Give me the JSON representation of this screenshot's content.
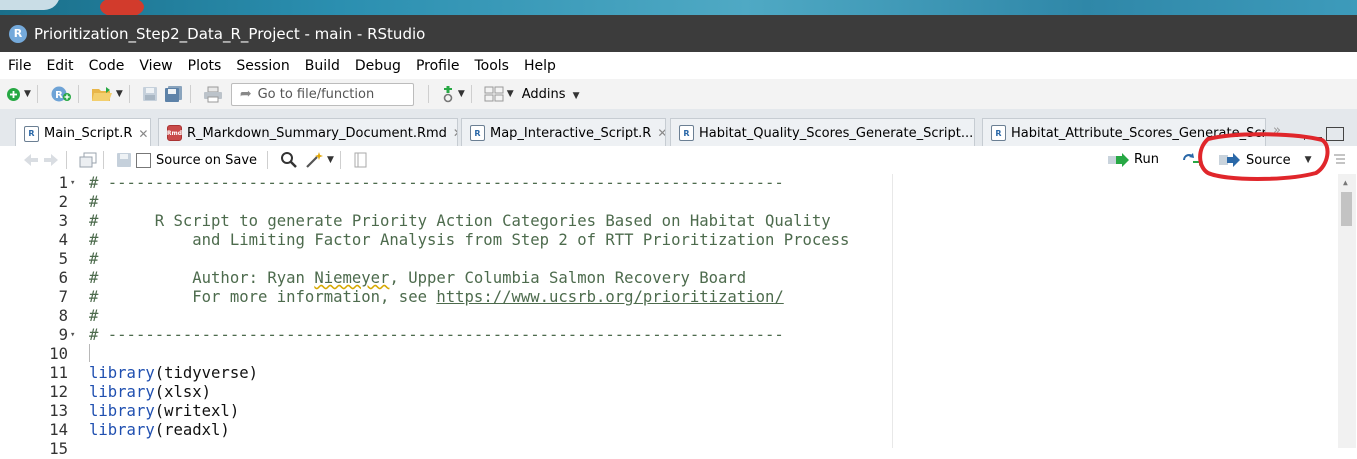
{
  "window": {
    "title": "Prioritization_Step2_Data_R_Project - main - RStudio",
    "app_icon_letter": "R"
  },
  "menu": [
    "File",
    "Edit",
    "Code",
    "View",
    "Plots",
    "Session",
    "Build",
    "Debug",
    "Profile",
    "Tools",
    "Help"
  ],
  "toolbar": {
    "goto_placeholder": "Go to file/function",
    "addins_label": "Addins"
  },
  "tabs": [
    {
      "label": "Main_Script.R",
      "icon": "r-file-icon",
      "active": true
    },
    {
      "label": "R_Markdown_Summary_Document.Rmd",
      "icon": "rmd-file-icon",
      "active": false
    },
    {
      "label": "Map_Interactive_Script.R",
      "icon": "r-file-icon",
      "active": false
    },
    {
      "label": "Habitat_Quality_Scores_Generate_Script...",
      "icon": "r-file-icon",
      "active": false
    },
    {
      "label": "Habitat_Attribute_Scores_Generate_Scri",
      "icon": "r-file-icon",
      "active": false
    }
  ],
  "editor_toolbar": {
    "source_on_save_label": "Source on Save",
    "run_label": "Run",
    "source_label": "Source"
  },
  "code_lines": [
    {
      "n": "1",
      "fold": true,
      "text": "# ------------------------------------------------------------------------",
      "type": "comment"
    },
    {
      "n": "2",
      "text": "#",
      "type": "comment"
    },
    {
      "n": "3",
      "text": "#      R Script to generate Priority Action Categories Based on Habitat Quality",
      "type": "comment"
    },
    {
      "n": "4",
      "text": "#          and Limiting Factor Analysis from Step 2 of RTT Prioritization Process",
      "type": "comment"
    },
    {
      "n": "5",
      "text": "#",
      "type": "comment"
    },
    {
      "n": "6",
      "text": "#          Author: Ryan Niemeyer, Upper Columbia Salmon Recovery Board",
      "type": "comment"
    },
    {
      "n": "7",
      "text": "#          For more information, see https://www.ucsrb.org/prioritization/",
      "type": "comment"
    },
    {
      "n": "8",
      "text": "#",
      "type": "comment"
    },
    {
      "n": "9",
      "fold": true,
      "text": "# ------------------------------------------------------------------------",
      "type": "comment"
    },
    {
      "n": "10",
      "text": "",
      "type": "plain"
    },
    {
      "n": "11",
      "fn": "library",
      "arg": "(tidyverse)",
      "type": "call"
    },
    {
      "n": "12",
      "fn": "library",
      "arg": "(xlsx)",
      "type": "call"
    },
    {
      "n": "13",
      "fn": "library",
      "arg": "(writexl)",
      "type": "call"
    },
    {
      "n": "14",
      "fn": "library",
      "arg": "(readxl)",
      "type": "call"
    },
    {
      "n": "15",
      "text": "",
      "type": "plain"
    }
  ],
  "colors": {
    "title_bar": "#3c3c3c",
    "comment": "#4d6b4d",
    "function": "#1f4fb0",
    "annotation": "#e0262b"
  }
}
